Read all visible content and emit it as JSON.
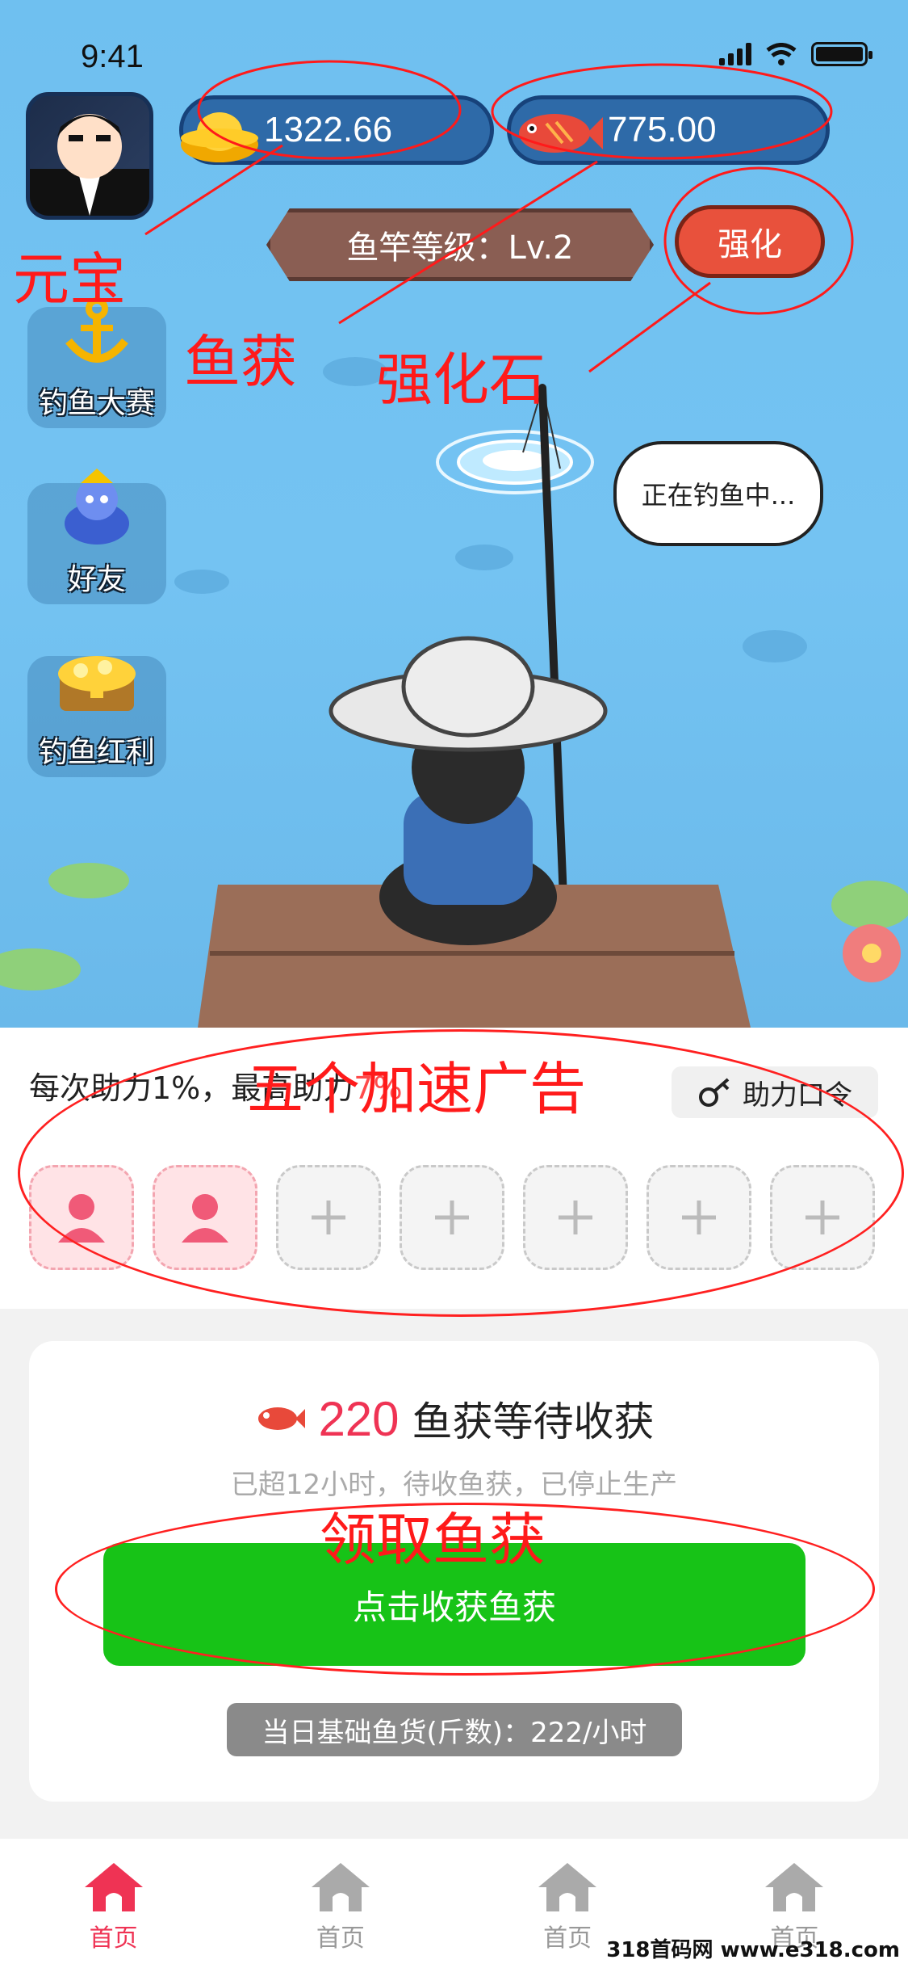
{
  "status_bar": {
    "time": "9:41"
  },
  "header": {
    "gold_value": "1322.66",
    "fish_value": "775.00",
    "rod_level": "鱼竿等级：Lv.2",
    "upgrade_label": "强化"
  },
  "side_menu": [
    {
      "label": "钓鱼大赛",
      "icon": "anchor-icon"
    },
    {
      "label": "好友",
      "icon": "friend-character-icon"
    },
    {
      "label": "钓鱼红利",
      "icon": "treasure-chest-icon"
    }
  ],
  "scene": {
    "bubble_text": "正在钓鱼中..."
  },
  "annotations": {
    "gold": "元宝",
    "fish": "鱼获",
    "stone": "强化石",
    "ads": "五个加速广告",
    "collect": "领取鱼获"
  },
  "boost": {
    "text_prefix": "每次助力1%，最高助力",
    "text_highlight": "7%",
    "code_button": "助力口令",
    "slots": [
      {
        "state": "filled"
      },
      {
        "state": "filled"
      },
      {
        "state": "empty"
      },
      {
        "state": "empty"
      },
      {
        "state": "empty"
      },
      {
        "state": "empty"
      },
      {
        "state": "empty"
      }
    ]
  },
  "harvest": {
    "count": "220",
    "label": "鱼获等待收获",
    "note": "已超12小时，待收鱼获，已停止生产",
    "collect_button": "点击收获鱼获",
    "base_rate": "当日基础鱼货(斤数)：222/小时"
  },
  "tabs": [
    {
      "label": "首页",
      "active": true
    },
    {
      "label": "首页",
      "active": false
    },
    {
      "label": "首页",
      "active": false
    },
    {
      "label": "首页",
      "active": false
    }
  ],
  "watermark": "318首码网 www.e318.com",
  "colors": {
    "accent": "#ef3354",
    "collect_green": "#17c317",
    "annotation_red": "#ff1a1a"
  }
}
